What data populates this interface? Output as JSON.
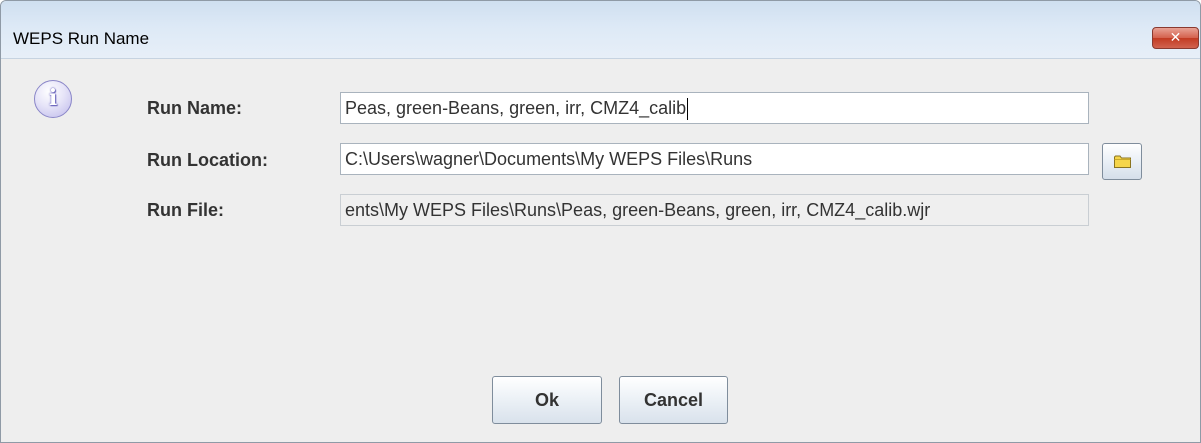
{
  "window": {
    "title": "WEPS Run Name",
    "close_glyph": "✕"
  },
  "icons": {
    "info": "i",
    "info_icon_name": "information-icon",
    "folder_icon_name": "folder-icon"
  },
  "form": {
    "run_name_label": "Run Name:",
    "run_name_value": "Peas, green-Beans, green, irr, CMZ4_calib",
    "run_location_label": "Run Location:",
    "run_location_value": "C:\\Users\\wagner\\Documents\\My WEPS Files\\Runs",
    "run_file_label": "Run File:",
    "run_file_value": "ents\\My WEPS Files\\Runs\\Peas, green-Beans, green, irr, CMZ4_calib.wjr"
  },
  "buttons": {
    "ok_label": "Ok",
    "cancel_label": "Cancel"
  },
  "colors": {
    "titlebar": "#dde9f6",
    "close_button": "#c8432b",
    "dialog_background": "#eeeeee",
    "folder": "#f5d54a"
  }
}
